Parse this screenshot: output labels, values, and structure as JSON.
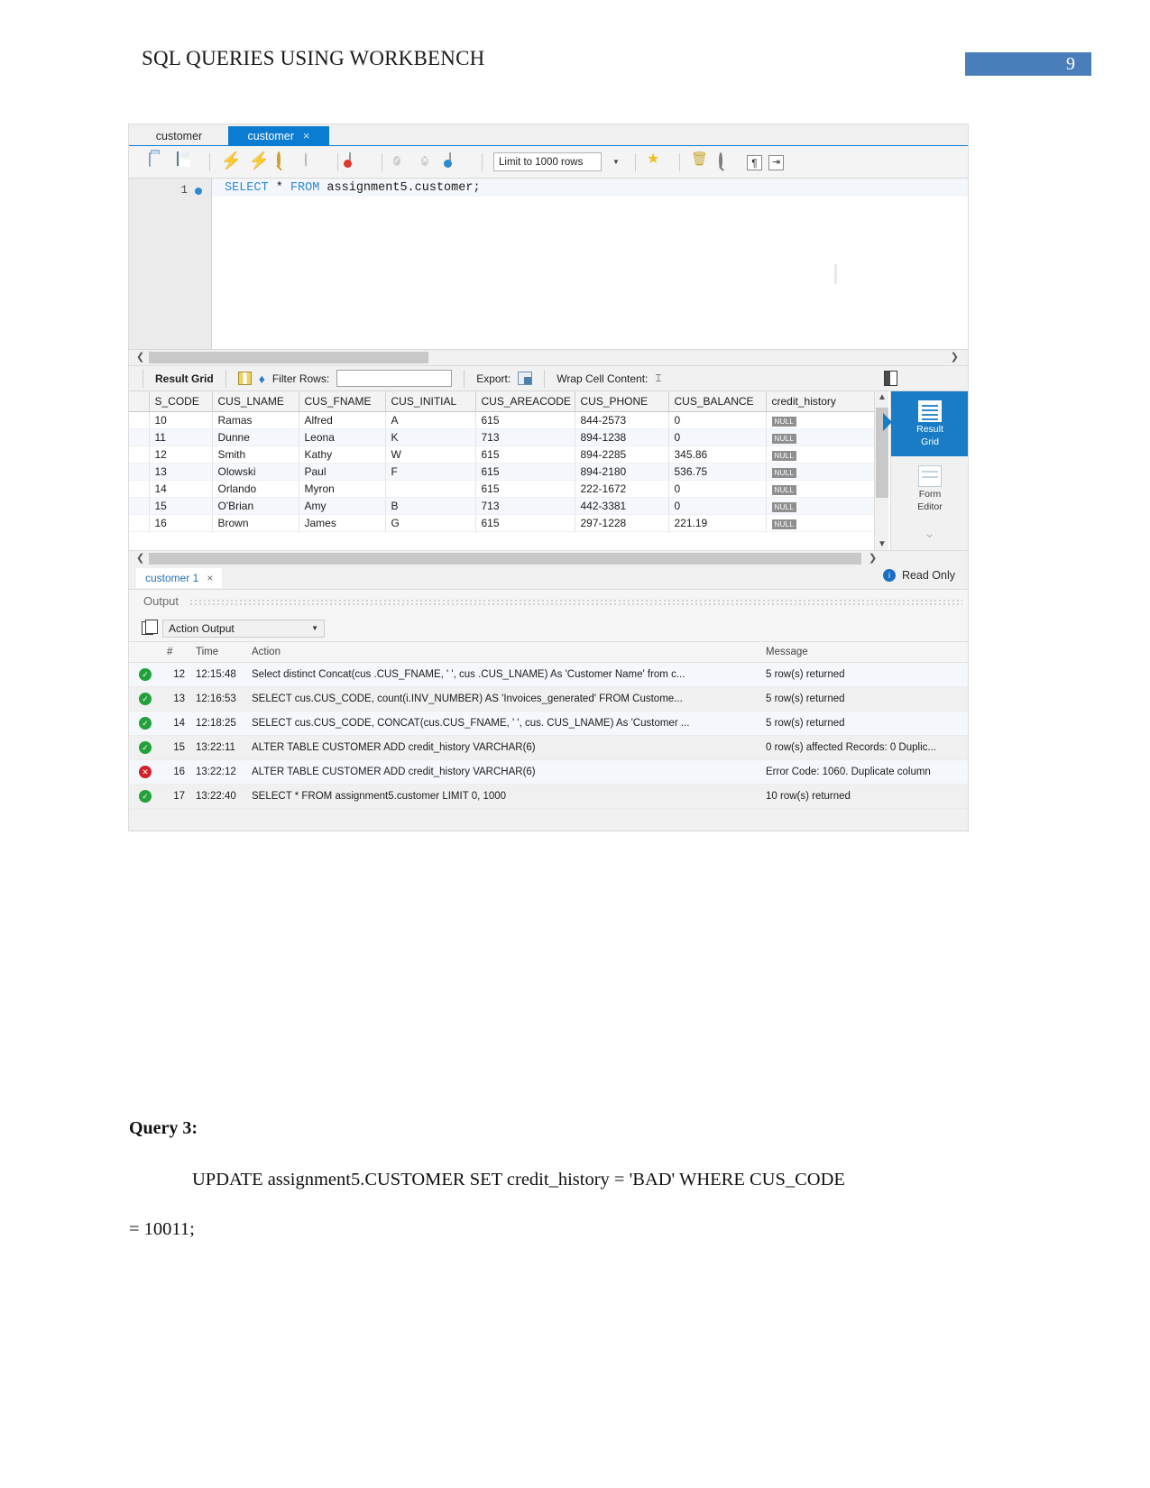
{
  "document": {
    "header_title": "SQL QUERIES USING WORKBENCH",
    "page_number": "9",
    "page_badge_color": "#4a7ebb",
    "query_heading": "Query 3:",
    "query_line_1": "UPDATE assignment5.CUSTOMER SET credit_history = 'BAD' WHERE CUS_CODE",
    "query_line_2": "= 10011;"
  },
  "workbench": {
    "editor_tabs": [
      {
        "label": "customer",
        "active": false,
        "closable": false
      },
      {
        "label": "customer",
        "active": true,
        "closable": true,
        "close_label": "×"
      }
    ],
    "toolbar": {
      "icons": [
        "open-folder-icon",
        "save-icon",
        "execute-bolt-icon",
        "execute-current-bolt-icon",
        "explain-magnifier-icon",
        "stop-icon",
        "toggle-schema-icon",
        "commit-icon",
        "rollback-icon",
        "autocommit-icon"
      ],
      "limit_label": "Limit to 1000 rows",
      "right_icons": [
        "beautify-star-icon",
        "clear-broom-icon",
        "find-icon",
        "paragraph-icon",
        "wrap-icon"
      ]
    },
    "sql_editor": {
      "line_number": "1",
      "code_keyword_1": "SELECT",
      "code_star": " * ",
      "code_keyword_2": "FROM",
      "code_rest": " assignment5.customer;"
    },
    "result_toolbar": {
      "result_grid_label": "Result Grid",
      "filter_label": "Filter Rows:",
      "filter_value": "",
      "export_label": "Export:",
      "wrap_label": "Wrap Cell Content:",
      "wrap_glyph": "⌶"
    },
    "grid": {
      "columns": [
        "",
        "S_CODE",
        "CUS_LNAME",
        "CUS_FNAME",
        "CUS_INITIAL",
        "CUS_AREACODE",
        "CUS_PHONE",
        "CUS_BALANCE",
        "credit_history"
      ],
      "null_label": "NULL",
      "rows": [
        {
          "code": "10",
          "lname": "Ramas",
          "fname": "Alfred",
          "initial": "A",
          "areacode": "615",
          "phone": "844-2573",
          "balance": "0",
          "credit": "NULL"
        },
        {
          "code": "11",
          "lname": "Dunne",
          "fname": "Leona",
          "initial": "K",
          "areacode": "713",
          "phone": "894-1238",
          "balance": "0",
          "credit": "NULL"
        },
        {
          "code": "12",
          "lname": "Smith",
          "fname": "Kathy",
          "initial": "W",
          "areacode": "615",
          "phone": "894-2285",
          "balance": "345.86",
          "credit": "NULL"
        },
        {
          "code": "13",
          "lname": "Olowski",
          "fname": "Paul",
          "initial": "F",
          "areacode": "615",
          "phone": "894-2180",
          "balance": "536.75",
          "credit": "NULL"
        },
        {
          "code": "14",
          "lname": "Orlando",
          "fname": "Myron",
          "initial": "",
          "areacode": "615",
          "phone": "222-1672",
          "balance": "0",
          "credit": "NULL"
        },
        {
          "code": "15",
          "lname": "O'Brian",
          "fname": "Amy",
          "initial": "B",
          "areacode": "713",
          "phone": "442-3381",
          "balance": "0",
          "credit": "NULL"
        },
        {
          "code": "16",
          "lname": "Brown",
          "fname": "James",
          "initial": "G",
          "areacode": "615",
          "phone": "297-1228",
          "balance": "221.19",
          "credit": "NULL"
        }
      ]
    },
    "side_panel": {
      "items": [
        {
          "label_line1": "Result",
          "label_line2": "Grid",
          "active": true
        },
        {
          "label_line1": "Form",
          "label_line2": "Editor",
          "active": false
        }
      ]
    },
    "result_tab": {
      "label": "customer 1",
      "close_label": "×",
      "read_only": "Read Only",
      "info_glyph": "i"
    },
    "output": {
      "section_label": "Output",
      "selector_value": "Action Output",
      "columns": [
        "",
        "#",
        "Time",
        "Action",
        "Message"
      ],
      "rows": [
        {
          "status": "ok",
          "num": "12",
          "time": "12:15:48",
          "action": "Select distinct Concat(cus .CUS_FNAME, ' ', cus .CUS_LNAME) As 'Customer Name' from c...",
          "message": "5 row(s) returned"
        },
        {
          "status": "ok",
          "num": "13",
          "time": "12:16:53",
          "action": "SELECT cus.CUS_CODE, count(i.INV_NUMBER) AS 'Invoices_generated' FROM Custome...",
          "message": "5 row(s) returned"
        },
        {
          "status": "ok",
          "num": "14",
          "time": "12:18:25",
          "action": "SELECT cus.CUS_CODE, CONCAT(cus.CUS_FNAME, ' ', cus. CUS_LNAME) As 'Customer ...",
          "message": "5 row(s) returned"
        },
        {
          "status": "ok",
          "num": "15",
          "time": "13:22:11",
          "action": "ALTER TABLE CUSTOMER ADD credit_history VARCHAR(6)",
          "message": "0 row(s) affected Records: 0  Duplic..."
        },
        {
          "status": "error",
          "num": "16",
          "time": "13:22:12",
          "action": "ALTER TABLE CUSTOMER ADD credit_history VARCHAR(6)",
          "message": "Error Code: 1060. Duplicate column"
        },
        {
          "status": "ok",
          "num": "17",
          "time": "13:22:40",
          "action": "SELECT * FROM assignment5.customer LIMIT 0, 1000",
          "message": "10 row(s) returned"
        }
      ]
    }
  }
}
